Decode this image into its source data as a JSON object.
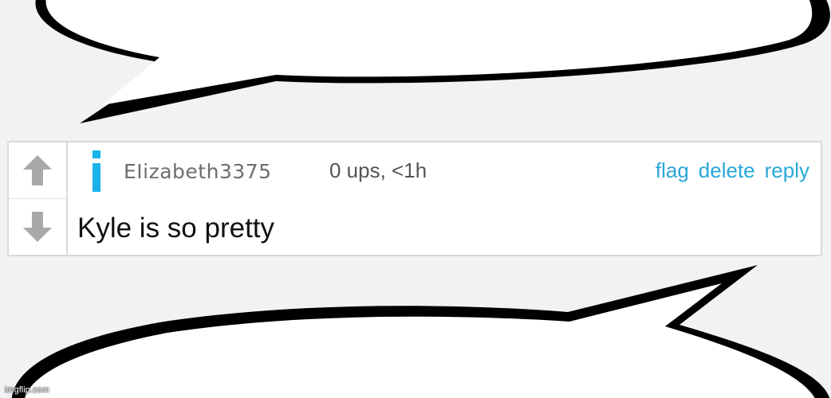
{
  "comment": {
    "username": "EIizabeth3375",
    "meta": "0 ups, <1h",
    "actions": {
      "flag": "flag",
      "delete": "delete",
      "reply": "reply"
    },
    "text": "Kyle is so pretty"
  },
  "watermark": "imgflip.com",
  "icons": {
    "upvote": "arrow-up-icon",
    "downvote": "arrow-down-icon",
    "info": "info-icon"
  },
  "colors": {
    "link": "#29a8d6",
    "info_icon": "#1ab3ea",
    "vote_arrow": "#a9a9a9",
    "background": "#f0f2f3"
  }
}
